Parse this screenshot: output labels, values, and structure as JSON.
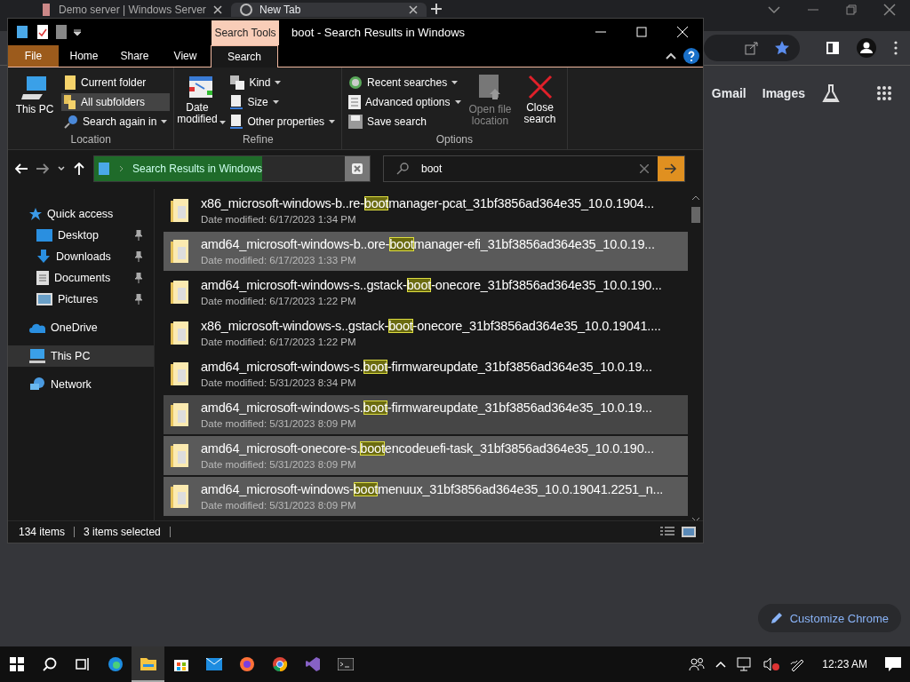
{
  "browser": {
    "tabs": [
      {
        "title": "Demo server | Windows Server",
        "selected": false
      },
      {
        "title": "New Tab",
        "selected": true
      }
    ],
    "links": [
      "Gmail",
      "Images"
    ],
    "customize_button": "Customize Chrome"
  },
  "explorer": {
    "title": "boot - Search Results in Windows",
    "context_tab": "Search Tools",
    "tabs": [
      {
        "label": "File",
        "kind": "file",
        "selected": false
      },
      {
        "label": "Home",
        "kind": "tab",
        "selected": false
      },
      {
        "label": "Share",
        "kind": "tab",
        "selected": false
      },
      {
        "label": "View",
        "kind": "tab",
        "selected": false
      },
      {
        "label": "Search",
        "kind": "tab",
        "selected": true
      }
    ],
    "ribbon": [
      {
        "label": "Location",
        "items": [
          {
            "kind": "large",
            "label": "This PC",
            "dropdown": false,
            "disabled": false
          },
          {
            "kind": "stack",
            "items": [
              {
                "label": "Current folder",
                "dropdown": false,
                "selected": false
              },
              {
                "label": "All subfolders",
                "dropdown": false,
                "selected": true
              },
              {
                "label": "Search again in",
                "dropdown": true,
                "selected": false
              }
            ]
          }
        ]
      },
      {
        "label": "Refine",
        "items": [
          {
            "kind": "large",
            "label": "Date modified",
            "dropdown": true,
            "disabled": false
          },
          {
            "kind": "stack",
            "items": [
              {
                "label": "Kind",
                "dropdown": true,
                "selected": false
              },
              {
                "label": "Size",
                "dropdown": true,
                "selected": false
              },
              {
                "label": "Other properties",
                "dropdown": true,
                "selected": false
              }
            ]
          }
        ]
      },
      {
        "label": "Options",
        "items": [
          {
            "kind": "stack",
            "items": [
              {
                "label": "Recent searches",
                "dropdown": true,
                "selected": false
              },
              {
                "label": "Advanced options",
                "dropdown": true,
                "selected": false
              },
              {
                "label": "Save search",
                "dropdown": false,
                "selected": false
              }
            ]
          },
          {
            "kind": "large",
            "label": "Open file location",
            "dropdown": false,
            "disabled": true
          },
          {
            "kind": "large",
            "label": "Close search",
            "dropdown": false,
            "disabled": false
          }
        ]
      }
    ],
    "address": {
      "location": "Search Results in Windows",
      "level": 0.61
    },
    "search": {
      "value": "boot"
    },
    "nav": [
      {
        "label": "Quick access",
        "selected": false,
        "children": [
          {
            "label": "Desktop",
            "pinned": true,
            "selected": false
          },
          {
            "label": "Downloads",
            "pinned": true,
            "selected": false
          },
          {
            "label": "Documents",
            "pinned": true,
            "selected": false
          },
          {
            "label": "Pictures",
            "pinned": true,
            "selected": false
          }
        ]
      },
      {
        "label": "OneDrive",
        "selected": false
      },
      {
        "label": "This PC",
        "selected": true
      },
      {
        "label": "Network",
        "selected": false
      }
    ],
    "results": [
      {
        "name_start": "x86_microsoft-windows-b..re-",
        "match": "boot",
        "name_end": "manager-pcat_31bf3856ad364e35_10.0.1904...",
        "date": "Date modified: 6/17/2023 1:34 PM",
        "selected": false,
        "hovered": false
      },
      {
        "name_start": "amd64_microsoft-windows-b..ore-",
        "match": "boot",
        "name_end": "manager-efi_31bf3856ad364e35_10.0.19...",
        "date": "Date modified: 6/17/2023 1:33 PM",
        "selected": true,
        "hovered": false
      },
      {
        "name_start": "amd64_microsoft-windows-s..gstack-",
        "match": "boot",
        "name_end": "-onecore_31bf3856ad364e35_10.0.190...",
        "date": "Date modified: 6/17/2023 1:22 PM",
        "selected": false,
        "hovered": false
      },
      {
        "name_start": "x86_microsoft-windows-s..gstack-",
        "match": "boot",
        "name_end": "-onecore_31bf3856ad364e35_10.0.19041....",
        "date": "Date modified: 6/17/2023 1:22 PM",
        "selected": false,
        "hovered": false
      },
      {
        "name_start": "amd64_microsoft-windows-s.",
        "match": "boot",
        "name_end": "-firmwareupdate_31bf3856ad364e35_10.0.19...",
        "date": "Date modified: 5/31/2023 8:34 PM",
        "selected": false,
        "hovered": false
      },
      {
        "name_start": "amd64_microsoft-windows-s.",
        "match": "boot",
        "name_end": "-firmwareupdate_31bf3856ad364e35_10.0.19...",
        "date": "Date modified: 5/31/2023 8:09 PM",
        "selected": false,
        "hovered": true
      },
      {
        "name_start": "amd64_microsoft-onecore-s.",
        "match": "boot",
        "name_end": "encodeuefi-task_31bf3856ad364e35_10.0.190...",
        "date": "Date modified: 5/31/2023 8:09 PM",
        "selected": true,
        "hovered": false
      },
      {
        "name_start": "amd64_microsoft-windows-",
        "match": "boot",
        "name_end": "menuux_31bf3856ad364e35_10.0.19041.2251_n...",
        "date": "Date modified: 5/31/2023 8:09 PM",
        "selected": true,
        "hovered": false
      }
    ],
    "status": {
      "count": "134 items",
      "selection": "3 items selected"
    }
  },
  "taskbar": {
    "clock": "12:23 AM"
  }
}
